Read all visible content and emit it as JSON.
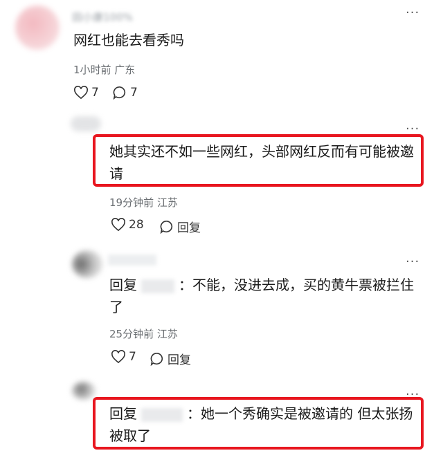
{
  "comments": [
    {
      "author": "田小康100%",
      "text": "网红也能去看秀吗",
      "meta": "1小时前 广东",
      "likes": "7",
      "replies": "7"
    },
    {
      "text": "她其实还不如一些网红，头部网红反而有可能被邀请",
      "meta": "19分钟前 江苏",
      "likes": "28",
      "reply_label": "回复"
    },
    {
      "reply_prefix": "回复",
      "text_line1": "：不能，没进去成，买的黄牛票被拦住",
      "text_line2": "了",
      "meta": "25分钟前 江苏",
      "likes": "7",
      "reply_label": "回复"
    },
    {
      "reply_prefix": "回复",
      "text_line1": "：她一个秀确实是被邀请的 但太张扬",
      "text_line2": "被取了"
    }
  ],
  "icons": {
    "like": "heart-icon",
    "reply": "speech-bubble-icon",
    "more": "more-dots-icon"
  },
  "colors": {
    "highlight": "#e8161f"
  }
}
